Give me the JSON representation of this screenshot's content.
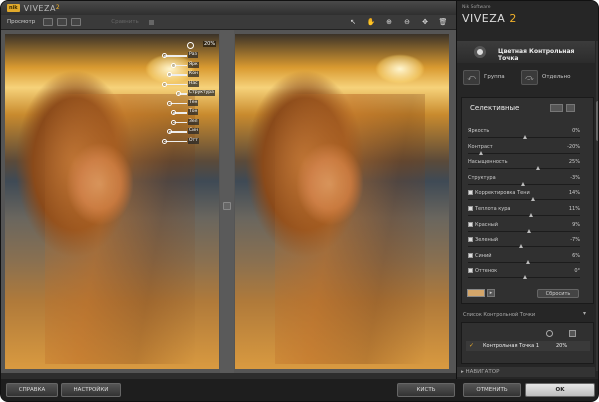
{
  "app": {
    "logo_text": "nik",
    "name": "VIVEZA",
    "version": "2"
  },
  "toolbar": {
    "preview_label": "Просмотр",
    "compare_label": "Сравнить"
  },
  "tools": [
    "hand-icon",
    "zoom-in-icon",
    "zoom-out-icon",
    "move-icon",
    "trash-icon",
    "cursor-icon"
  ],
  "control_point": {
    "percent": "20%",
    "labels": [
      "Раз",
      "Ярк",
      "Кон",
      "Нас",
      "Структура",
      "Тен",
      "Тон",
      "Зел",
      "Син",
      "Отт"
    ],
    "levels_percent": [
      50,
      30,
      40,
      50,
      20,
      40,
      30,
      30,
      40,
      50
    ]
  },
  "panel": {
    "brand_small": "Nik Software",
    "brand": "VIVEZA",
    "brand_version": "2",
    "header_title": "Цветная Контрольная Точка",
    "group_label": "Группа",
    "separate_label": "Отдельно",
    "section_title": "Селективные",
    "sliders": [
      {
        "name": "Яркость",
        "value": "0%",
        "level": 0.5,
        "check": false
      },
      {
        "name": "Контраст",
        "value": "-20%",
        "level": 0.1,
        "check": false
      },
      {
        "name": "Насыщенность",
        "value": "25%",
        "level": 0.62,
        "check": false
      },
      {
        "name": "Структура",
        "value": "-3%",
        "level": 0.48,
        "check": false
      },
      {
        "name": "Корректировка Тени",
        "value": "14%",
        "level": 0.57,
        "check": true
      },
      {
        "name": "Теплота кура",
        "value": "11%",
        "level": 0.55,
        "check": true
      },
      {
        "name": "Красный",
        "value": "9%",
        "level": 0.54,
        "check": true
      },
      {
        "name": "Зеленый",
        "value": "-7%",
        "level": 0.46,
        "check": true
      },
      {
        "name": "Синий",
        "value": "6%",
        "level": 0.53,
        "check": true
      },
      {
        "name": "Оттенок",
        "value": "0°",
        "level": 0.5,
        "check": true
      }
    ],
    "swatch_color": "#d4a66a",
    "reset_label": "Сбросить",
    "list_title": "Список Контрольной Точки",
    "list_item": {
      "name": "Контрольная Точка 1",
      "percent": "20%"
    },
    "navigator_label": "▸ НАВИГАТОР"
  },
  "bottom": {
    "help": "СПРАВКА",
    "settings": "НАСТРОЙКИ",
    "brush": "КИСТЬ",
    "cancel": "ОТМЕНИТЬ",
    "ok": "OK"
  }
}
